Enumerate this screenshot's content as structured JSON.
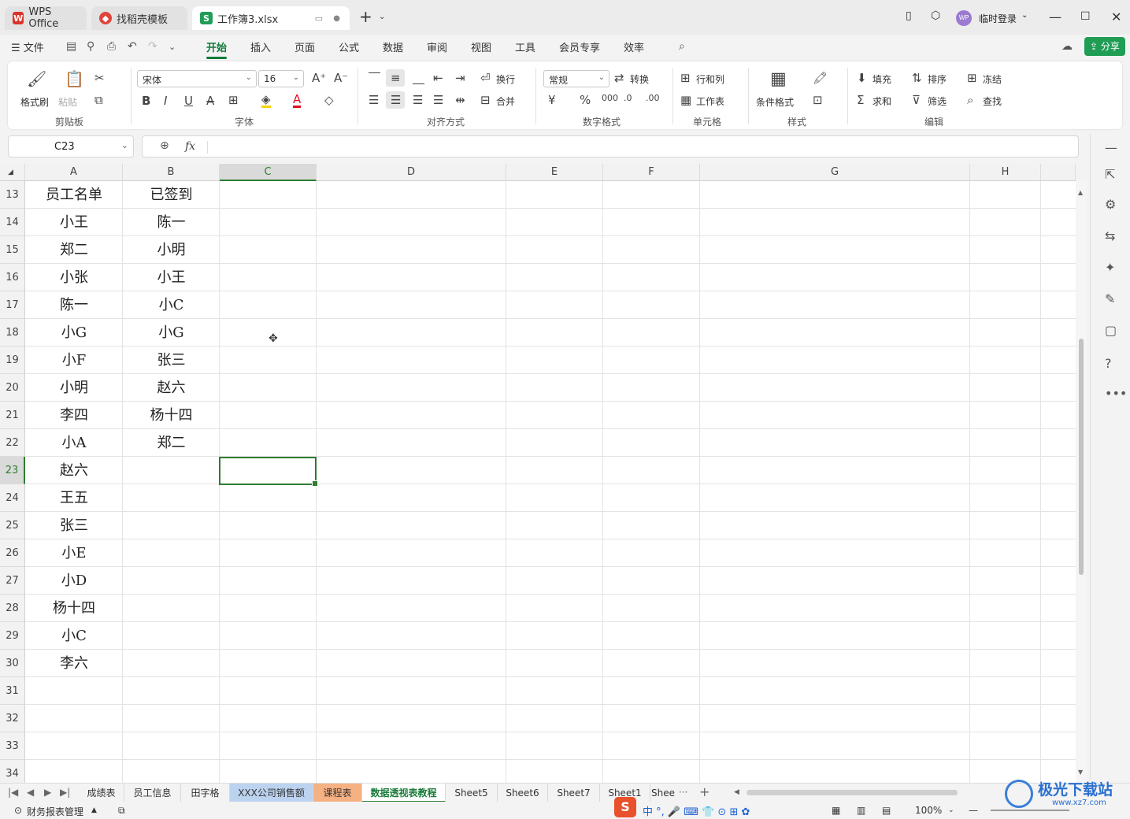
{
  "window": {
    "tabs": [
      {
        "label": "WPS Office",
        "icon": "wps-logo-icon"
      },
      {
        "label": "找稻壳模板",
        "icon": "docer-icon"
      },
      {
        "label": "工作簿3.xlsx",
        "icon": "spreadsheet-icon"
      }
    ],
    "user_label": "临时登录",
    "avatar_text": "WP"
  },
  "menu": {
    "file": "文件",
    "items": [
      "开始",
      "插入",
      "页面",
      "公式",
      "数据",
      "审阅",
      "视图",
      "工具",
      "会员专享",
      "效率"
    ],
    "active": "开始",
    "share": "分享"
  },
  "ribbon": {
    "clipboard": {
      "format_painter": "格式刷",
      "paste": "粘贴",
      "group": "剪贴板"
    },
    "font": {
      "name": "宋体",
      "size": "16",
      "group": "字体"
    },
    "align": {
      "wrap": "换行",
      "merge": "合并",
      "group": "对齐方式"
    },
    "number": {
      "format": "常规",
      "convert": "转换",
      "group": "数字格式"
    },
    "cells": {
      "rowcol": "行和列",
      "sheet": "工作表",
      "group": "单元格"
    },
    "style": {
      "conditional": "条件格式",
      "group": "样式"
    },
    "edit": {
      "fill": "填充",
      "sort": "排序",
      "freeze": "冻结",
      "sum": "求和",
      "filter": "筛选",
      "find": "查找",
      "group": "编辑"
    }
  },
  "formula_bar": {
    "cell_ref": "C23",
    "fx": "fx",
    "value": ""
  },
  "columns": [
    "A",
    "B",
    "C",
    "D",
    "E",
    "F",
    "G",
    "H"
  ],
  "selected_column": "C",
  "rows": [
    {
      "num": "13",
      "a": "员工名单",
      "b": "已签到"
    },
    {
      "num": "14",
      "a": "小王",
      "b": "陈一"
    },
    {
      "num": "15",
      "a": "郑二",
      "b": "小明"
    },
    {
      "num": "16",
      "a": "小张",
      "b": "小王"
    },
    {
      "num": "17",
      "a": "陈一",
      "b": "小C"
    },
    {
      "num": "18",
      "a": "小G",
      "b": "小G"
    },
    {
      "num": "19",
      "a": "小F",
      "b": "张三"
    },
    {
      "num": "20",
      "a": "小明",
      "b": "赵六"
    },
    {
      "num": "21",
      "a": "李四",
      "b": "杨十四"
    },
    {
      "num": "22",
      "a": "小A",
      "b": "郑二"
    },
    {
      "num": "23",
      "a": "赵六",
      "b": ""
    },
    {
      "num": "24",
      "a": "王五",
      "b": ""
    },
    {
      "num": "25",
      "a": "张三",
      "b": ""
    },
    {
      "num": "26",
      "a": "小E",
      "b": ""
    },
    {
      "num": "27",
      "a": "小D",
      "b": ""
    },
    {
      "num": "28",
      "a": "杨十四",
      "b": ""
    },
    {
      "num": "29",
      "a": "小C",
      "b": ""
    },
    {
      "num": "30",
      "a": "李六",
      "b": ""
    },
    {
      "num": "31",
      "a": "",
      "b": ""
    },
    {
      "num": "32",
      "a": "",
      "b": ""
    },
    {
      "num": "33",
      "a": "",
      "b": ""
    },
    {
      "num": "34",
      "a": "",
      "b": ""
    }
  ],
  "selected_row": "23",
  "sheet_tabs": [
    {
      "label": "成绩表",
      "color": ""
    },
    {
      "label": "员工信息",
      "color": ""
    },
    {
      "label": "田字格",
      "color": ""
    },
    {
      "label": "XXX公司销售额",
      "color": "#bcd3f0"
    },
    {
      "label": "课程表",
      "color": "#f6b183"
    },
    {
      "label": "数据透视表教程",
      "color": "#ffffff"
    },
    {
      "label": "Sheet5",
      "color": ""
    },
    {
      "label": "Sheet6",
      "color": ""
    },
    {
      "label": "Sheet7",
      "color": ""
    },
    {
      "label": "Sheet1",
      "color": ""
    },
    {
      "label": "Shee",
      "color": ""
    }
  ],
  "status": {
    "workbook_label": "财务报表管理",
    "zoom": "100%"
  },
  "watermark": {
    "text": "极光下载站",
    "url": "www.xz7.com"
  },
  "colors": {
    "accent": "#2e7d32",
    "wps_red": "#d9342b"
  }
}
